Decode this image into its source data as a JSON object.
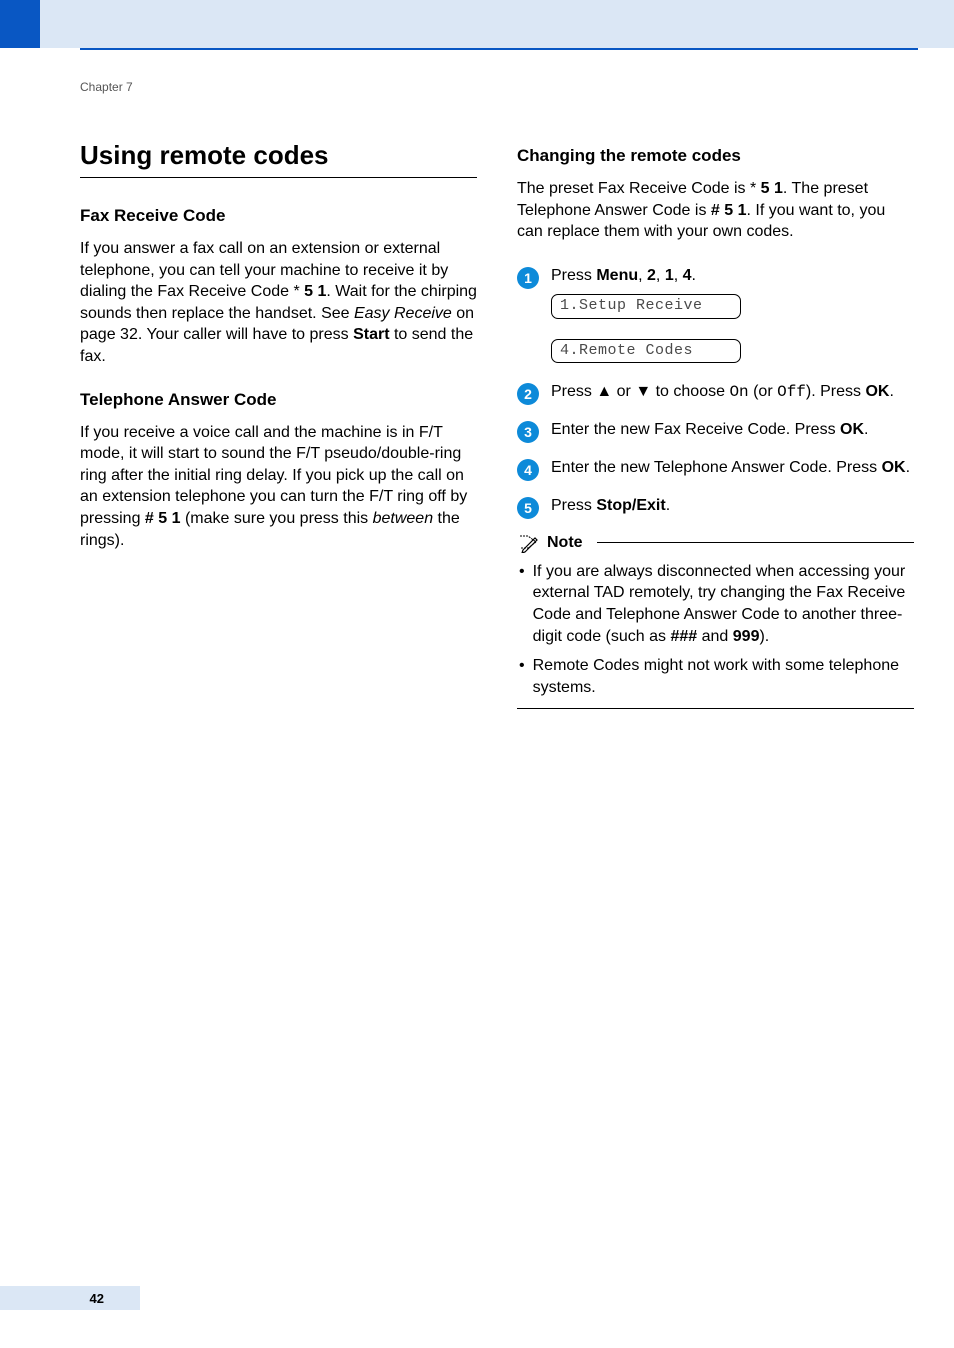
{
  "chapter": "Chapter 7",
  "page_number": "42",
  "h1": "Using remote codes",
  "left": {
    "fax_heading": "Fax Receive Code",
    "fax_p_1": "If you answer a fax call on an extension or external telephone, you can tell your machine to receive it by dialing the Fax Receive Code ",
    "asterisk": "*",
    "fax_code_bold": " 5 1",
    "fax_p_2": ". Wait for the chirping sounds then replace the handset. See ",
    "easy_receive_italic": "Easy Receive",
    "fax_p_3": " on page 32. Your caller will have to press ",
    "start_bold": "Start",
    "fax_p_4": " to send the fax.",
    "tac_heading": "Telephone Answer Code",
    "tac_p_1": "If you receive a voice call and the machine is in F/T mode, it will start to sound the F/T pseudo/double-ring ring after the initial ring delay. If you pick up the call on an extension telephone you can turn the F/T ring off by pressing ",
    "tac_code_bold": "# 5 1",
    "tac_p_2": " (make sure you press this ",
    "between_italic": "between",
    "tac_p_3": " the rings)."
  },
  "right": {
    "change_heading": "Changing the remote codes",
    "change_p_1a": "The preset Fax Receive Code is ",
    "asterisk2": "*",
    "code51": " 5 1",
    "change_p_1b": ". The preset Telephone Answer Code is ",
    "codeh51": "# 5 1",
    "change_p_1c": ". If you want to, you can replace them with your own codes.",
    "step1_a": "Press ",
    "menu": "Menu",
    "comma": ", ",
    "two": "2",
    "one": "1",
    "four": "4",
    "period": ".",
    "lcd1": "1.Setup Receive",
    "lcd2": "4.Remote Codes",
    "step2_a": "Press ",
    "up": "▲",
    "or": " or ",
    "down": "▼",
    "step2_b": " to choose ",
    "on": "On",
    "step2_c": " (or ",
    "off": "Off",
    "step2_d": "). Press ",
    "ok": "OK",
    "step3": "Enter the new Fax Receive Code. Press ",
    "step4": "Enter the new Telephone Answer Code. Press ",
    "step5_a": "Press ",
    "stopexit": "Stop/Exit",
    "note_title": "Note",
    "note1_a": "If you are always disconnected when accessing your external TAD remotely, try changing the Fax Receive Code and Telephone Answer Code to another three-digit code (such as ",
    "hashes": "###",
    "and": " and ",
    "nines": "999",
    "note1_b": ").",
    "note2": "Remote Codes might not work with some telephone systems."
  }
}
